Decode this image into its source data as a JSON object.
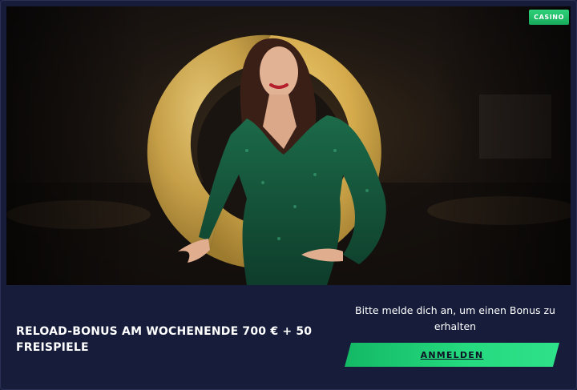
{
  "badge": {
    "label": "CASINO"
  },
  "offer": {
    "title": "RELOAD-BONUS AM WOCHENENDE 700 € + 50 FREISPIELE"
  },
  "login": {
    "prompt": "Bitte melde dich an, um einen Bonus zu erhalten",
    "button_label": "ANMELDEN"
  },
  "colors": {
    "accent_green": "#24d97e",
    "card_background": "#161c3a",
    "ring_gold": "#d7b052",
    "dress_green": "#15533a"
  },
  "hero": {
    "image": "casino-host-woman-green-dress"
  }
}
